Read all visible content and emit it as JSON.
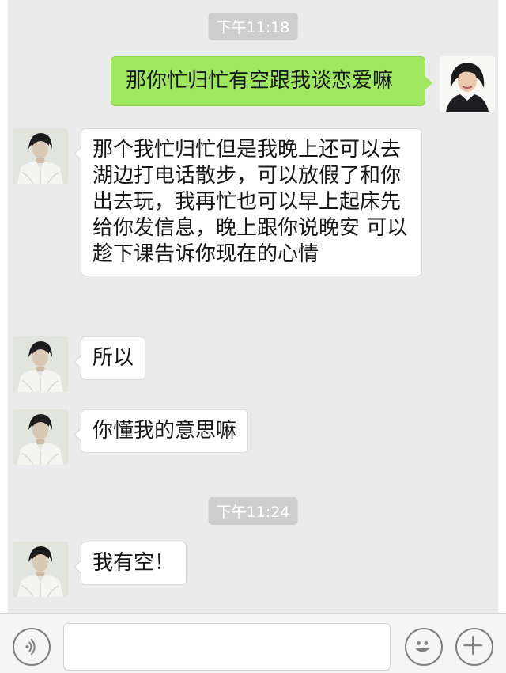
{
  "timestamps": [
    "下午11:18",
    "下午11:24"
  ],
  "messages": [
    {
      "sender": "me",
      "text": "那你忙归忙有空跟我谈恋爱嘛"
    },
    {
      "sender": "contact",
      "text": "那个我忙归忙但是我晚上还可以去湖边打电话散步，可以放假了和你出去玩，我再忙也可以早上起床先给你发信息，晚上跟你说晚安 可以趁下课告诉你现在的心情"
    },
    {
      "sender": "contact",
      "text": "所以"
    },
    {
      "sender": "contact",
      "text": "你懂我的意思嘛"
    },
    {
      "sender": "contact",
      "text": "我有空！"
    }
  ],
  "input_bar": {
    "voice_icon": "voice-icon",
    "emoji_icon": "emoji-icon",
    "add_icon": "plus-icon",
    "text_value": ""
  },
  "colors": {
    "chat_background": "#ebebeb",
    "sent_bubble": "#9fe75f",
    "received_bubble": "#ffffff",
    "timestamp_pill": "#cecece"
  }
}
